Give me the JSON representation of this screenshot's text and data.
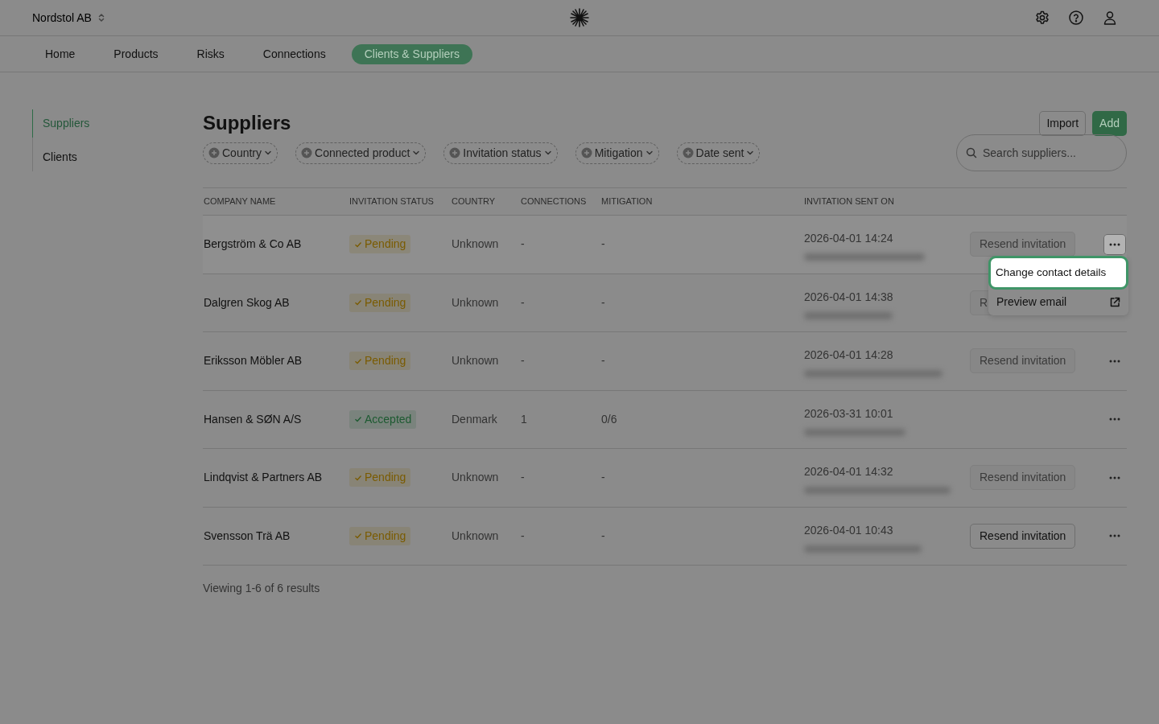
{
  "org_switcher": {
    "label": "Nordstol AB"
  },
  "nav": [
    {
      "label": "Home",
      "selected": false
    },
    {
      "label": "Products",
      "selected": false
    },
    {
      "label": "Risks",
      "selected": false
    },
    {
      "label": "Connections",
      "selected": false
    },
    {
      "label": "Clients & Suppliers",
      "selected": true
    }
  ],
  "sidebar": {
    "items": [
      {
        "label": "Suppliers",
        "selected": true
      },
      {
        "label": "Clients",
        "selected": false
      }
    ]
  },
  "page": {
    "title": "Suppliers",
    "buttons": [
      {
        "label": "Import",
        "kind": "outline"
      },
      {
        "label": "Add",
        "kind": "primary"
      }
    ]
  },
  "filters": [
    "Country",
    "Connected product",
    "Invitation status",
    "Mitigation",
    "Date sent"
  ],
  "search": {
    "placeholder": "Search suppliers..."
  },
  "table": {
    "columns": [
      "COMPANY NAME",
      "INVITATION STATUS",
      "COUNTRY",
      "CONNECTIONS",
      "MITIGATION",
      "INVITATION SENT ON"
    ],
    "rows": [
      {
        "company": "Bergström & Co AB",
        "status": {
          "label": "Pending",
          "color": "#7a5b00"
        },
        "country": "Unknown",
        "connections": "-",
        "mitigation": "-",
        "sent_on": "2026-04-01 14:24",
        "resend": {
          "label": "Resend invitation",
          "disabled": true
        },
        "menu_open": true
      },
      {
        "company": "Dalgren Skog AB",
        "status": {
          "label": "Pending",
          "color": "#7a5b00"
        },
        "country": "Unknown",
        "connections": "-",
        "mitigation": "-",
        "sent_on": "2026-04-01 14:38",
        "resend": {
          "label": "R",
          "disabled": true
        },
        "menu_open": false
      },
      {
        "company": "Eriksson Möbler AB",
        "status": {
          "label": "Pending",
          "color": "#7a5b00"
        },
        "country": "Unknown",
        "connections": "-",
        "mitigation": "-",
        "sent_on": "2026-04-01 14:28",
        "resend": {
          "label": "Resend invitation",
          "disabled": true
        },
        "menu_open": false
      },
      {
        "company": "Hansen & SØN A/S",
        "status": {
          "label": "Accepted",
          "color": "#1d5a31"
        },
        "country": "Denmark",
        "connections": "1",
        "mitigation": "0/6",
        "sent_on": "2026-03-31 10:01",
        "menu_open": false
      },
      {
        "company": "Lindqvist & Partners AB",
        "status": {
          "label": "Pending",
          "color": "#7a5b00"
        },
        "country": "Unknown",
        "connections": "-",
        "mitigation": "-",
        "sent_on": "2026-04-01 14:32",
        "resend": {
          "label": "Resend invitation",
          "disabled": true
        },
        "menu_open": false
      },
      {
        "company": "Svensson Trä AB",
        "status": {
          "label": "Pending",
          "color": "#7a5b00"
        },
        "country": "Unknown",
        "connections": "-",
        "mitigation": "-",
        "sent_on": "2026-04-01 10:43",
        "resend": {
          "label": "Resend invitation",
          "disabled": false
        },
        "menu_open": false
      }
    ]
  },
  "row_menu": {
    "items": [
      {
        "label": "Change contact details",
        "selected": true,
        "kind": "action"
      },
      {
        "label": "Preview email",
        "selected": false,
        "kind": "external"
      }
    ]
  },
  "footer": "Viewing 1-6 of 6 results"
}
